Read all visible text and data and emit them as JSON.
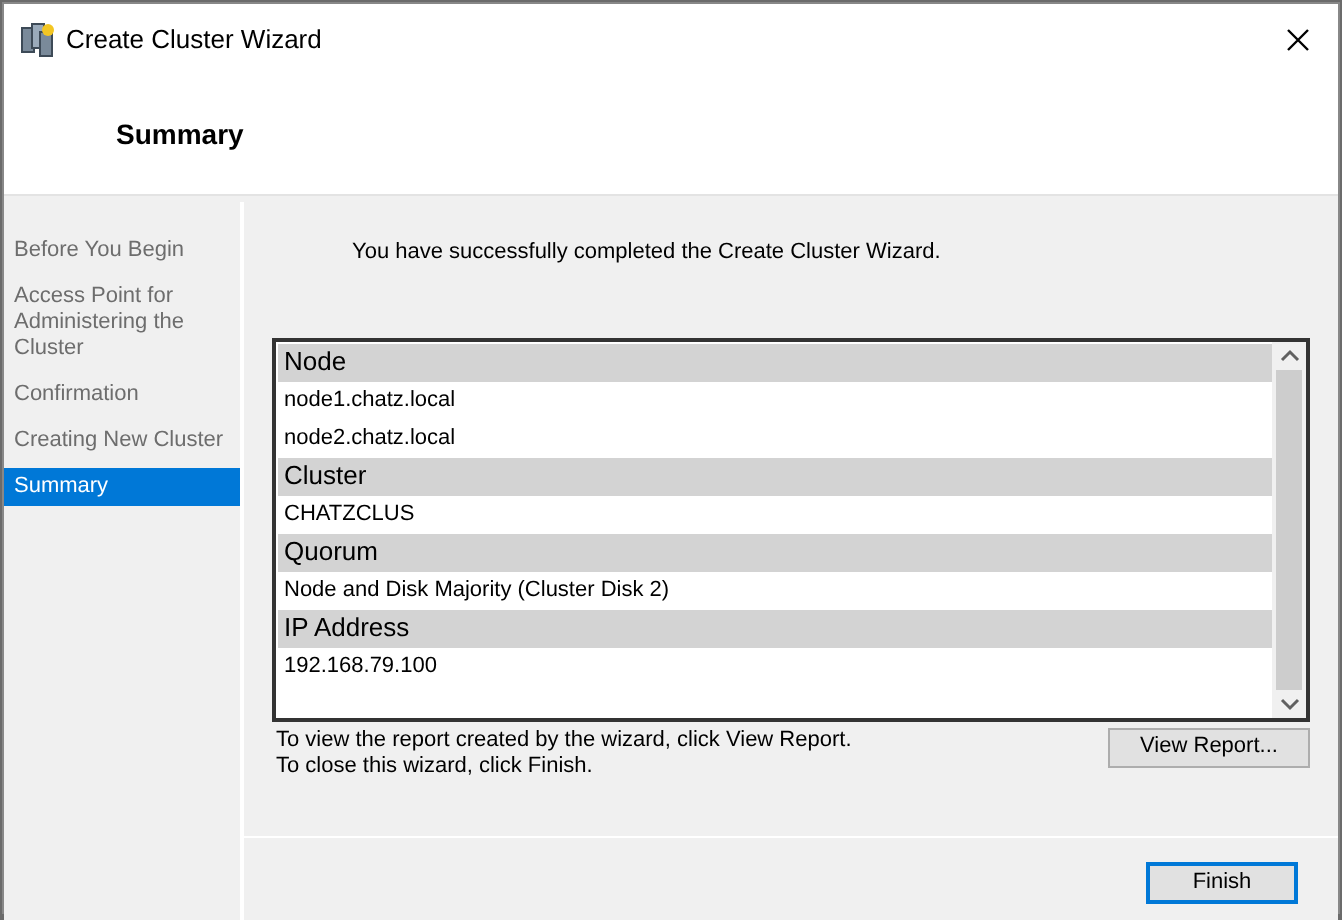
{
  "window": {
    "title": "Create Cluster Wizard"
  },
  "page_title": "Summary",
  "steps": [
    {
      "label": "Before You Begin",
      "selected": false
    },
    {
      "label": "Access Point for Administering the Cluster",
      "selected": false
    },
    {
      "label": "Confirmation",
      "selected": false
    },
    {
      "label": "Creating New Cluster",
      "selected": false
    },
    {
      "label": "Summary",
      "selected": true
    }
  ],
  "message": "You have successfully completed the Create Cluster Wizard.",
  "report": [
    {
      "kind": "header",
      "text": "Node"
    },
    {
      "kind": "value",
      "text": "node1.chatz.local"
    },
    {
      "kind": "value",
      "text": "node2.chatz.local"
    },
    {
      "kind": "header",
      "text": "Cluster"
    },
    {
      "kind": "value",
      "text": "CHATZCLUS"
    },
    {
      "kind": "header",
      "text": "Quorum"
    },
    {
      "kind": "value",
      "text": "Node and Disk Majority (Cluster Disk 2)"
    },
    {
      "kind": "header",
      "text": "IP Address"
    },
    {
      "kind": "value",
      "text": "192.168.79.100"
    }
  ],
  "hints": [
    "To view the report created by the wizard, click View Report.",
    "To close this wizard, click Finish."
  ],
  "view_report_button": "View Report...",
  "finish_button": "Finish"
}
